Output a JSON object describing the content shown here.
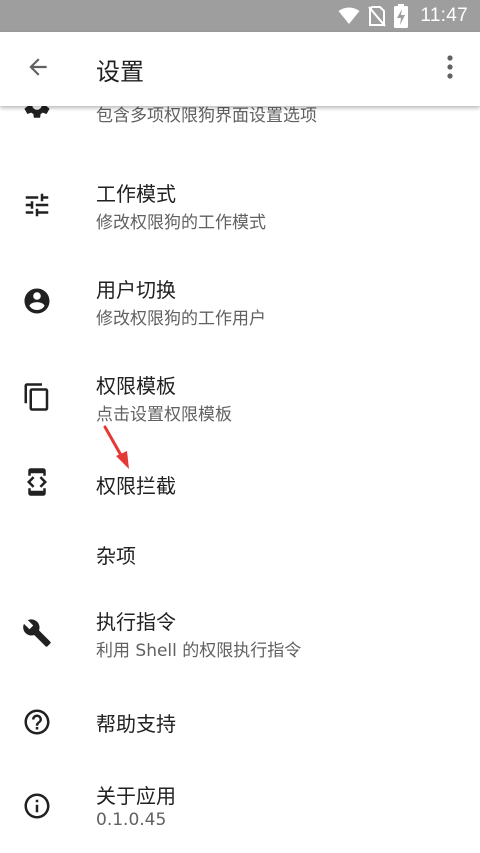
{
  "status_bar": {
    "time": "11:47",
    "icons": [
      "wifi-icon",
      "no-sim-icon",
      "battery-charging-icon"
    ]
  },
  "app_bar": {
    "title": "设置",
    "back_icon": "arrow-back-icon",
    "menu_icon": "more-vert-icon"
  },
  "settings": {
    "items": [
      {
        "title": "",
        "subtitle": "包含多项权限狗界面设置选项",
        "icon": "settings-gear-icon"
      },
      {
        "title": "工作模式",
        "subtitle": "修改权限狗的工作模式",
        "icon": "tune-icon"
      },
      {
        "title": "用户切换",
        "subtitle": "修改权限狗的工作用户",
        "icon": "account-circle-icon"
      },
      {
        "title": "权限模板",
        "subtitle": "点击设置权限模板",
        "icon": "content-copy-icon"
      },
      {
        "title": "权限拦截",
        "subtitle": "",
        "icon": "developer-mode-icon"
      },
      {
        "title": "杂项",
        "subtitle": "",
        "icon": ""
      },
      {
        "title": "执行指令",
        "subtitle": "利用 Shell 的权限执行指令",
        "icon": "wrench-icon"
      },
      {
        "title": "帮助支持",
        "subtitle": "",
        "icon": "help-circle-icon"
      },
      {
        "title": "关于应用",
        "subtitle": "0.1.0.45",
        "icon": "info-circle-icon"
      }
    ]
  },
  "annotation": {
    "color": "#e53935"
  },
  "colors": {
    "status_bar": "#9e9e9e",
    "icon": "#212121",
    "secondary_text": "#616161"
  }
}
